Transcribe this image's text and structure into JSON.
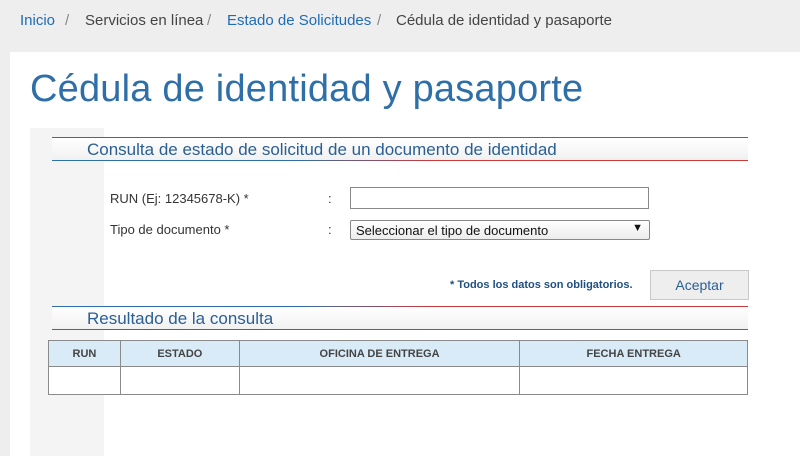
{
  "breadcrumb": {
    "items": [
      {
        "label": "Inicio"
      },
      {
        "label": "Servicios en línea"
      },
      {
        "label": "Estado de Solicitudes"
      },
      {
        "label": "Cédula de identidad y pasaporte"
      }
    ],
    "separator": "/"
  },
  "page": {
    "title": "Cédula de identidad y pasaporte"
  },
  "query_section": {
    "title": "Consulta de estado de solicitud de un documento de identidad",
    "run_label": "RUN (Ej: 12345678-K) *",
    "run_value": "",
    "doc_type_label": "Tipo de documento *",
    "doc_type_selected": "Seleccionar el tipo de documento",
    "colon": ":",
    "required_note": "* Todos los datos son obligatorios.",
    "accept_label": "Aceptar"
  },
  "result_section": {
    "title": "Resultado de la consulta",
    "columns": [
      "RUN",
      "ESTADO",
      "OFICINA DE ENTREGA",
      "FECHA ENTREGA"
    ]
  },
  "colors": {
    "link": "#1f6bb5",
    "title": "#2f6fa8",
    "table_header": "#d9ebf7",
    "accent_red": "#cc3a3a"
  },
  "icons": {
    "select_arrow": "dropdown-arrow-icon"
  }
}
